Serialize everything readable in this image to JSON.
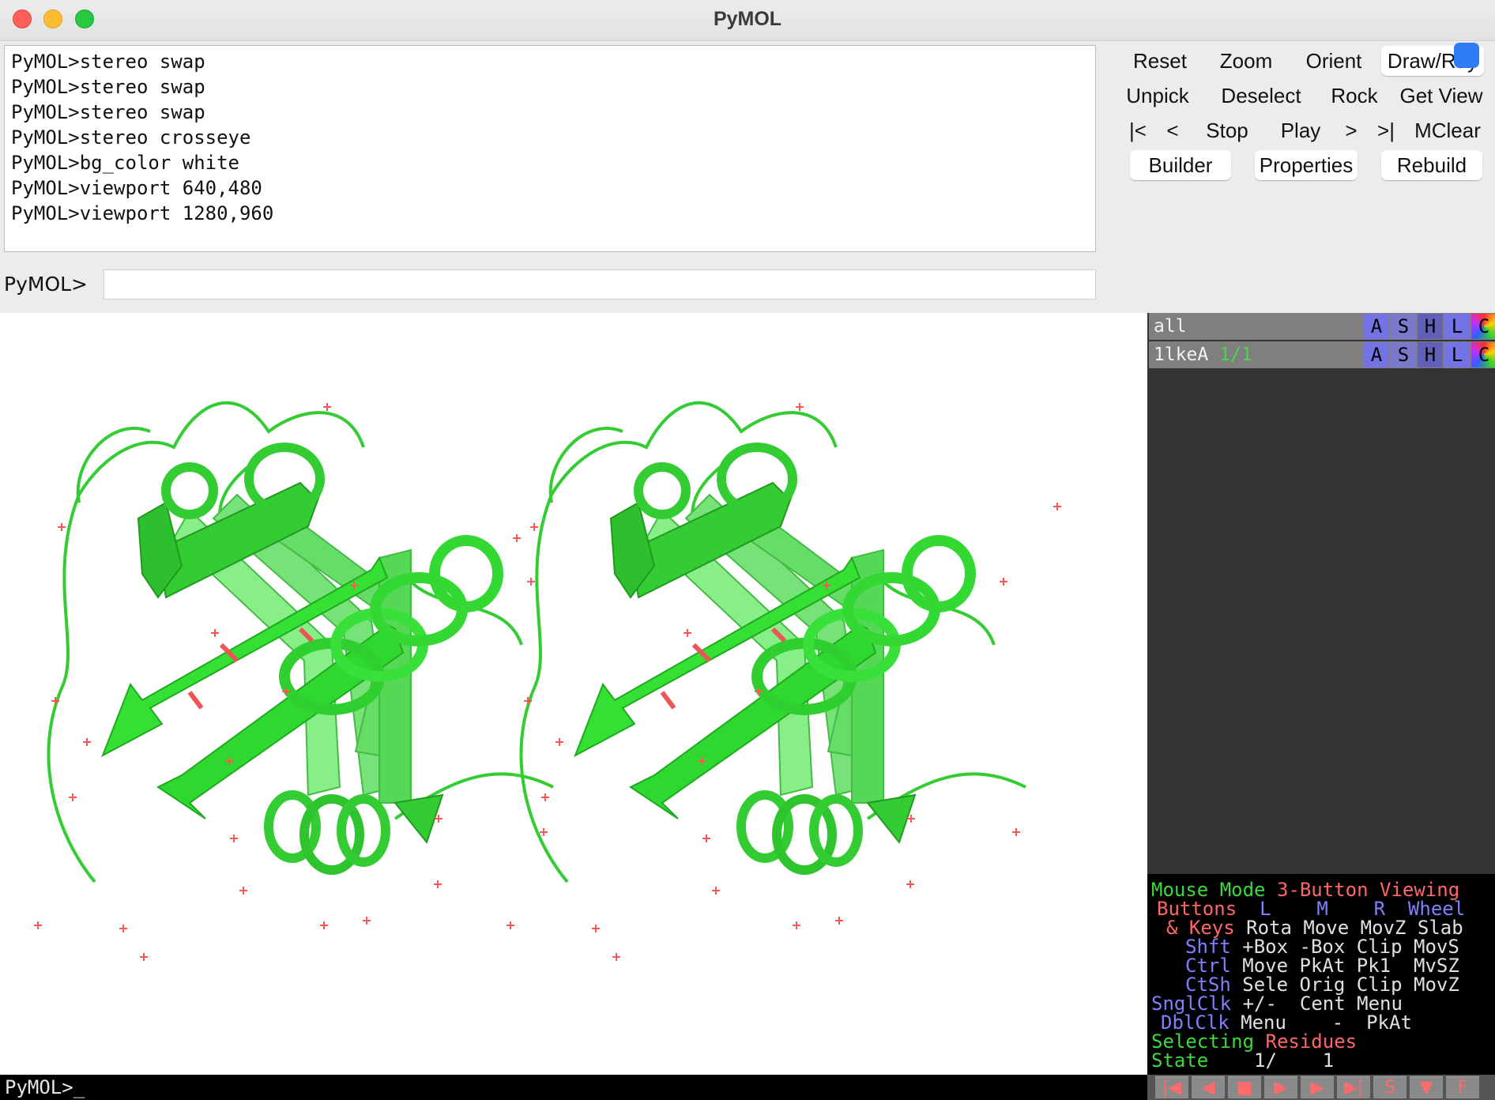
{
  "window": {
    "title": "PyMOL"
  },
  "console": {
    "lines": [
      "PyMOL>stereo swap",
      "PyMOL>stereo swap",
      "PyMOL>stereo swap",
      "PyMOL>stereo crosseye",
      "PyMOL>bg_color white",
      "PyMOL>viewport 640,480",
      "PyMOL>viewport 1280,960"
    ]
  },
  "command": {
    "prompt": "PyMOL>",
    "value": ""
  },
  "buttons": {
    "row1": [
      "Reset",
      "Zoom",
      "Orient",
      "Draw/Ray"
    ],
    "row2": [
      "Unpick",
      "Deselect",
      "Rock",
      "Get View"
    ],
    "row3": [
      "|<",
      "<",
      "Stop",
      "Play",
      ">",
      ">|",
      "MClear"
    ],
    "row4": [
      "Builder",
      "Properties",
      "Rebuild"
    ]
  },
  "viewer": {
    "background": "#ffffff",
    "cartoon_color": "#33dd33",
    "water_color": "#ff5555",
    "status_text": "PyMOL>_"
  },
  "objects": [
    {
      "name": "all",
      "state": "",
      "buttons": [
        "A",
        "S",
        "H",
        "L",
        "C"
      ]
    },
    {
      "name": "1lkeA",
      "state": "1/1",
      "buttons": [
        "A",
        "S",
        "H",
        "L",
        "C"
      ]
    }
  ],
  "mouse_mode": {
    "title": "Mouse Mode",
    "mode": "3-Button Viewing",
    "buttons_label": "Buttons",
    "button_cols": [
      "L",
      "M",
      "R",
      "Wheel"
    ],
    "rows": [
      {
        "label": "& Keys",
        "values": [
          "Rota",
          "Move",
          "MovZ",
          "Slab"
        ]
      },
      {
        "label": "Shft",
        "values": [
          "+Box",
          "-Box",
          "Clip",
          "MovS"
        ]
      },
      {
        "label": "Ctrl",
        "values": [
          "Move",
          "PkAt",
          "Pk1",
          "MvSZ"
        ]
      },
      {
        "label": "CtSh",
        "values": [
          "Sele",
          "Orig",
          "Clip",
          "MovZ"
        ]
      },
      {
        "label": "SnglClk",
        "values": [
          "+/-",
          "Cent",
          "Menu",
          ""
        ]
      },
      {
        "label": "DblClk",
        "values": [
          "Menu",
          "-",
          "PkAt",
          ""
        ]
      }
    ],
    "selecting_label": "Selecting",
    "selecting_value": "Residues",
    "state_label": "State",
    "state_value": "1/    1"
  },
  "movie_controls": [
    {
      "name": "rewind",
      "glyph": "|◀"
    },
    {
      "name": "back",
      "glyph": "◀"
    },
    {
      "name": "stop",
      "glyph": "■"
    },
    {
      "name": "play",
      "glyph": "▶"
    },
    {
      "name": "forward",
      "glyph": "▶"
    },
    {
      "name": "end",
      "glyph": "▶|"
    },
    {
      "name": "scene",
      "glyph": "S"
    },
    {
      "name": "menu",
      "glyph": "▼"
    },
    {
      "name": "full",
      "glyph": "F"
    }
  ]
}
